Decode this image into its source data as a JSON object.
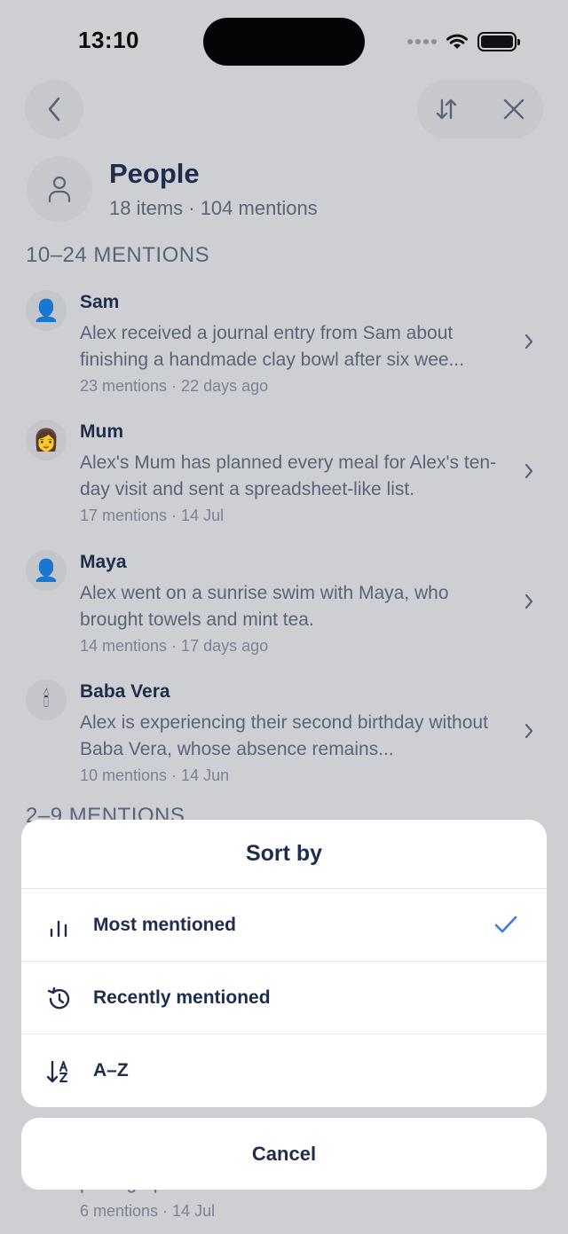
{
  "status": {
    "time": "13:10"
  },
  "header": {
    "title": "People",
    "subtitle": "18 items · 104 mentions"
  },
  "sections": [
    {
      "title": "10–24 MENTIONS"
    },
    {
      "title": "2–9 MENTIONS"
    }
  ],
  "people": [
    {
      "name": "Sam",
      "avatar": "👤",
      "description": "Alex received a journal entry from Sam about finishing a handmade clay bowl after six wee...",
      "meta": "23 mentions · 22 days ago"
    },
    {
      "name": "Mum",
      "avatar": "👩",
      "description": "Alex's Mum has planned every meal for Alex's ten-day visit and sent a spreadsheet-like list.",
      "meta": "17 mentions · 14 Jul"
    },
    {
      "name": "Maya",
      "avatar": "👤",
      "description": "Alex went on a sunrise swim with Maya, who brought towels and mint tea.",
      "meta": "14 mentions · 17 days ago"
    },
    {
      "name": "Baba Vera",
      "avatar": "🕯",
      "description": "Alex is experiencing their second birthday without Baba Vera, whose absence remains...",
      "meta": "10 mentions · 14 Jun"
    }
  ],
  "obscured_row": {
    "text": "photographs to Sofia.",
    "meta": "6 mentions · 14 Jul"
  },
  "sort_sheet": {
    "title": "Sort by",
    "options": [
      {
        "label": "Most mentioned",
        "icon": "bar-chart-icon",
        "selected": true
      },
      {
        "label": "Recently mentioned",
        "icon": "history-icon",
        "selected": false
      },
      {
        "label": "A–Z",
        "icon": "sort-alpha-icon",
        "selected": false
      }
    ],
    "cancel_label": "Cancel",
    "accent_color": "#3d7be0"
  }
}
